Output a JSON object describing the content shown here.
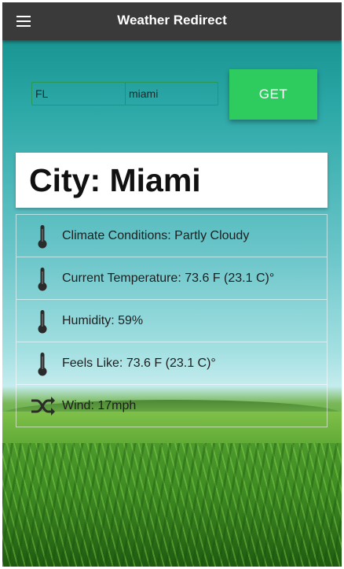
{
  "app": {
    "title": "Weather Redirect"
  },
  "form": {
    "state_value": "FL",
    "city_value": "miami",
    "get_label": "GET"
  },
  "city": {
    "heading": "City: Miami"
  },
  "conditions": [
    {
      "icon": "thermometer-icon",
      "text": "Climate Conditions: Partly Cloudy"
    },
    {
      "icon": "thermometer-icon",
      "text": "Current Temperature: 73.6 F (23.1 C)°"
    },
    {
      "icon": "thermometer-icon",
      "text": "Humidity: 59%"
    },
    {
      "icon": "thermometer-icon",
      "text": "Feels Like: 73.6 F (23.1 C)°"
    },
    {
      "icon": "wind-shuffle-icon",
      "text": "Wind: 17mph"
    }
  ],
  "colors": {
    "appbar": "#3a3a3a",
    "accent": "#2ecc5e",
    "card": "#ffffff"
  }
}
